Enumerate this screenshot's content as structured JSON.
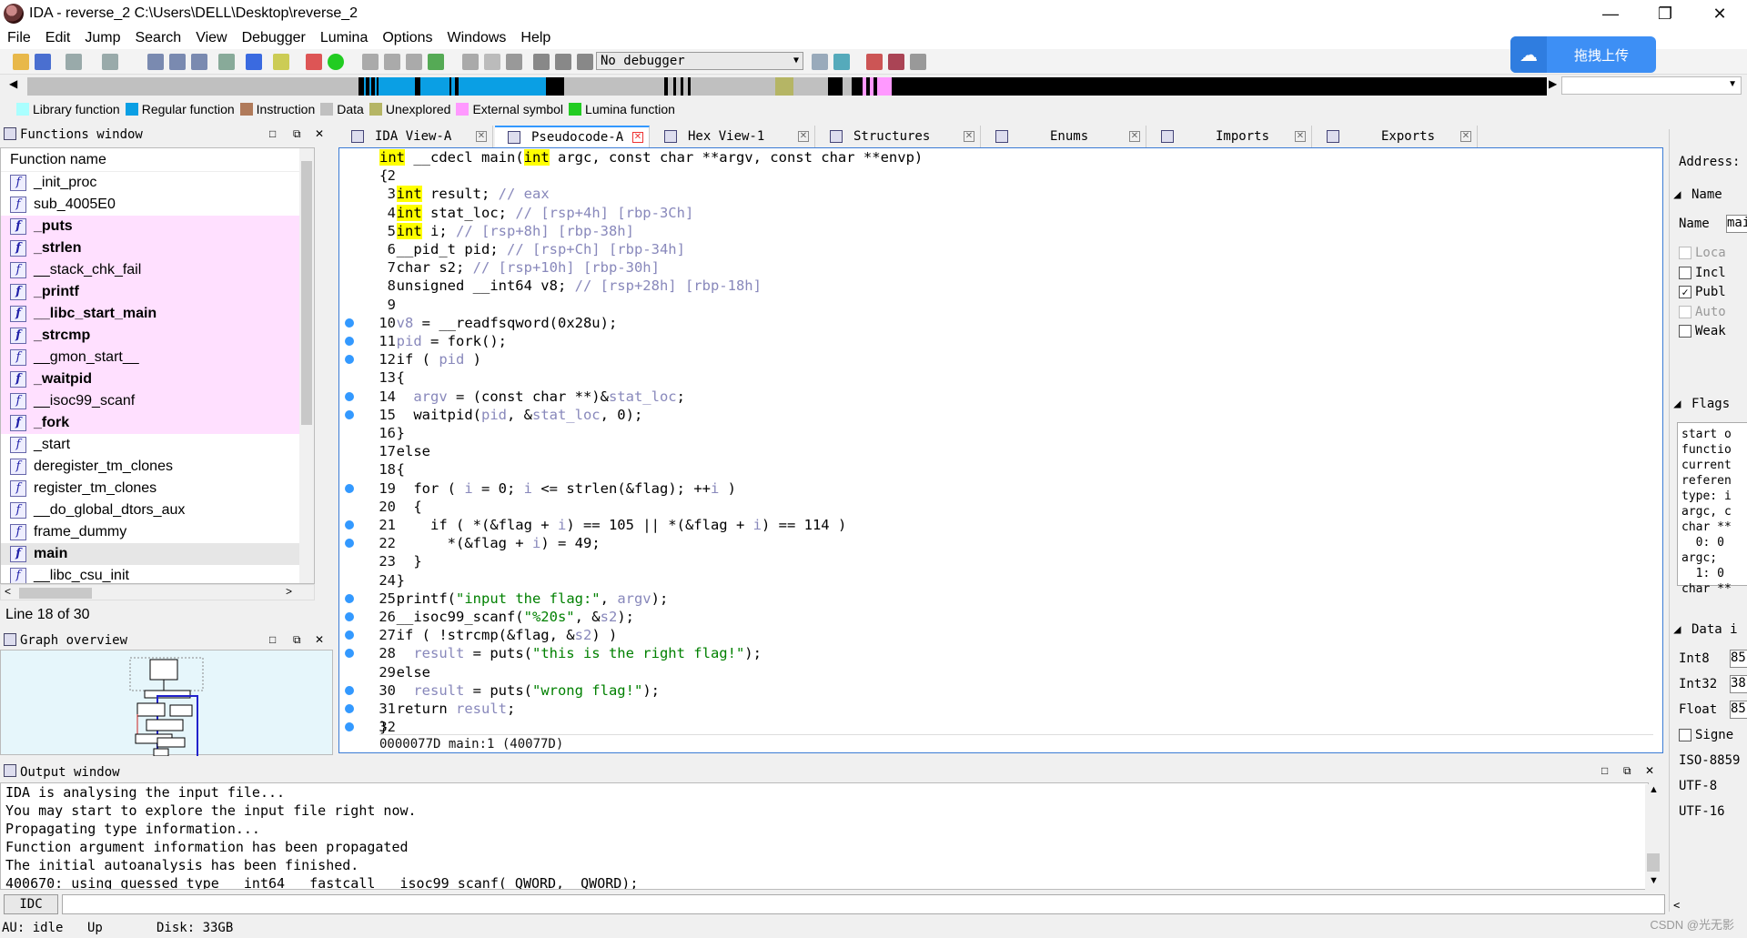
{
  "window": {
    "title": "IDA - reverse_2 C:\\Users\\DELL\\Desktop\\reverse_2",
    "minimize": "—",
    "restore": "❐",
    "close": "✕"
  },
  "menu": [
    "File",
    "Edit",
    "Jump",
    "Search",
    "View",
    "Debugger",
    "Lumina",
    "Options",
    "Windows",
    "Help"
  ],
  "toolbar": {
    "debugger_select": "No debugger"
  },
  "upload_button": {
    "label": "拖拽上传",
    "icon": "cloud-upload-icon"
  },
  "legend": [
    {
      "label": "Library function",
      "color": "#aaffff"
    },
    {
      "label": "Regular function",
      "color": "#0a9fe4"
    },
    {
      "label": "Instruction",
      "color": "#b07a5a"
    },
    {
      "label": "Data",
      "color": "#c0c0c0"
    },
    {
      "label": "Unexplored",
      "color": "#b5b565"
    },
    {
      "label": "External symbol",
      "color": "#ff99ff"
    },
    {
      "label": "Lumina function",
      "color": "#22cc22"
    }
  ],
  "functions_window": {
    "title": "Functions window",
    "column": "Function name",
    "items": [
      {
        "name": "_init_proc",
        "kind": "regular"
      },
      {
        "name": "sub_4005E0",
        "kind": "regular"
      },
      {
        "name": "_puts",
        "kind": "lib"
      },
      {
        "name": "_strlen",
        "kind": "lib"
      },
      {
        "name": "__stack_chk_fail",
        "kind": "lib-plain"
      },
      {
        "name": "_printf",
        "kind": "lib"
      },
      {
        "name": "__libc_start_main",
        "kind": "lib"
      },
      {
        "name": "_strcmp",
        "kind": "lib"
      },
      {
        "name": "__gmon_start__",
        "kind": "lib-plain"
      },
      {
        "name": "_waitpid",
        "kind": "lib"
      },
      {
        "name": "__isoc99_scanf",
        "kind": "lib-plain"
      },
      {
        "name": "_fork",
        "kind": "lib"
      },
      {
        "name": "_start",
        "kind": "regular"
      },
      {
        "name": "deregister_tm_clones",
        "kind": "regular"
      },
      {
        "name": "register_tm_clones",
        "kind": "regular"
      },
      {
        "name": "__do_global_dtors_aux",
        "kind": "regular"
      },
      {
        "name": "frame_dummy",
        "kind": "regular"
      },
      {
        "name": "main",
        "kind": "selected"
      },
      {
        "name": "__libc_csu_init",
        "kind": "regular"
      }
    ],
    "line_info": "Line 18 of 30"
  },
  "graph_overview": {
    "title": "Graph overview"
  },
  "tabs": [
    {
      "label": "IDA View-A"
    },
    {
      "label": "Pseudocode-A"
    },
    {
      "label": "Hex View-1"
    },
    {
      "label": "Structures"
    },
    {
      "label": "Enums"
    },
    {
      "label": "Imports"
    },
    {
      "label": "Exports"
    }
  ],
  "code_lines": [
    {
      "n": "1",
      "dot": false,
      "html": "<span class='kw-hl'>int</span> __cdecl main(<span class='kw-hl'>int</span> argc, const char **argv, const char **envp)"
    },
    {
      "n": "2",
      "dot": false,
      "html": "{"
    },
    {
      "n": "3",
      "dot": false,
      "html": "  <span class='kw-hl'>int</span> result; <span class='c-cmt'>// eax</span>"
    },
    {
      "n": "4",
      "dot": false,
      "html": "  <span class='kw-hl'>int</span> stat_loc; <span class='c-cmt'>// [rsp+4h] [rbp-3Ch]</span>"
    },
    {
      "n": "5",
      "dot": false,
      "html": "  <span class='kw-hl'>int</span> i; <span class='c-cmt'>// [rsp+8h] [rbp-38h]</span>"
    },
    {
      "n": "6",
      "dot": false,
      "html": "  __pid_t pid; <span class='c-cmt'>// [rsp+Ch] [rbp-34h]</span>"
    },
    {
      "n": "7",
      "dot": false,
      "html": "  char s2; <span class='c-cmt'>// [rsp+10h] [rbp-30h]</span>"
    },
    {
      "n": "8",
      "dot": false,
      "html": "  unsigned __int64 v8; <span class='c-cmt'>// [rsp+28h] [rbp-18h]</span>"
    },
    {
      "n": "9",
      "dot": false,
      "html": ""
    },
    {
      "n": "10",
      "dot": true,
      "html": "  <span class='c-var'>v8</span> = __readfsqword(0x28u);"
    },
    {
      "n": "11",
      "dot": true,
      "html": "  <span class='c-var'>pid</span> = fork();"
    },
    {
      "n": "12",
      "dot": true,
      "html": "  if ( <span class='c-var'>pid</span> )"
    },
    {
      "n": "13",
      "dot": false,
      "html": "  {"
    },
    {
      "n": "14",
      "dot": true,
      "html": "    <span class='c-var'>argv</span> = (const char **)&amp;<span class='c-var'>stat_loc</span>;"
    },
    {
      "n": "15",
      "dot": true,
      "html": "    waitpid(<span class='c-var'>pid</span>, &amp;<span class='c-var'>stat_loc</span>, 0);"
    },
    {
      "n": "16",
      "dot": false,
      "html": "  }"
    },
    {
      "n": "17",
      "dot": false,
      "html": "  else"
    },
    {
      "n": "18",
      "dot": false,
      "html": "  {"
    },
    {
      "n": "19",
      "dot": true,
      "html": "    for ( <span class='c-var'>i</span> = 0; <span class='c-var'>i</span> &lt;= strlen(&amp;flag); ++<span class='c-var'>i</span> )"
    },
    {
      "n": "20",
      "dot": false,
      "html": "    {"
    },
    {
      "n": "21",
      "dot": true,
      "html": "      if ( *(&amp;flag + <span class='c-var'>i</span>) == 105 || *(&amp;flag + <span class='c-var'>i</span>) == 114 )"
    },
    {
      "n": "22",
      "dot": true,
      "html": "        *(&amp;flag + <span class='c-var'>i</span>) = 49;"
    },
    {
      "n": "23",
      "dot": false,
      "html": "    }"
    },
    {
      "n": "24",
      "dot": false,
      "html": "  }"
    },
    {
      "n": "25",
      "dot": true,
      "html": "  printf(<span class='c-str'>\"input the flag:\"</span>, <span class='c-var'>argv</span>);"
    },
    {
      "n": "26",
      "dot": true,
      "html": "  __isoc99_scanf(<span class='c-str'>\"%20s\"</span>, &amp;<span class='c-var'>s2</span>);"
    },
    {
      "n": "27",
      "dot": true,
      "html": "  if ( !strcmp(&amp;flag, &amp;<span class='c-var'>s2</span>) )"
    },
    {
      "n": "28",
      "dot": true,
      "html": "    <span class='c-var'>result</span> = puts(<span class='c-str'>\"this is the right flag!\"</span>);"
    },
    {
      "n": "29",
      "dot": false,
      "html": "  else"
    },
    {
      "n": "30",
      "dot": true,
      "html": "    <span class='c-var'>result</span> = puts(<span class='c-str'>\"wrong flag!\"</span>);"
    },
    {
      "n": "31",
      "dot": true,
      "html": "  return <span class='c-var'>result</span>;"
    },
    {
      "n": "32",
      "dot": true,
      "html": "}"
    }
  ],
  "code_status": "0000077D main:1 (40077D)",
  "right_panel": {
    "address_label": "Address:",
    "name_section": "Name",
    "name_label": "Name",
    "name_value": "mai",
    "checkboxes": [
      {
        "label": "Loca",
        "checked": false,
        "disabled": true
      },
      {
        "label": "Incl",
        "checked": false,
        "disabled": false
      },
      {
        "label": "Publ",
        "checked": true,
        "disabled": false
      },
      {
        "label": "Auto",
        "checked": false,
        "disabled": true
      },
      {
        "label": "Weak",
        "checked": false,
        "disabled": false
      }
    ],
    "flags_section": "Flags",
    "flags_lines": [
      "start o",
      "functio",
      "current",
      "referen",
      "type: i",
      "argc, c",
      "char **",
      "  0: 0",
      "argc;",
      "  1: 0",
      "char **"
    ],
    "data_section": "Data i",
    "data_rows": [
      {
        "label": "Int8",
        "value": "85"
      },
      {
        "label": "Int32",
        "value": "38"
      },
      {
        "label": "Float",
        "value": "85"
      }
    ],
    "signed_label": "Signe",
    "encodings": [
      "ISO-8859",
      "UTF-8",
      "UTF-16"
    ]
  },
  "output_window": {
    "title": "Output window",
    "lines": [
      "IDA is analysing the input file...",
      "You may start to explore the input file right now.",
      "Propagating type information...",
      "Function argument information has been propagated",
      "The initial autoanalysis has been finished.",
      "400670: using guessed type __int64 __fastcall __isoc99_scanf(_QWORD, _QWORD);"
    ]
  },
  "idc_button": "IDC",
  "status": {
    "au": "AU:  idle",
    "dir": "Up",
    "disk": "Disk: 33GB"
  },
  "watermark": "CSDN @光无影"
}
